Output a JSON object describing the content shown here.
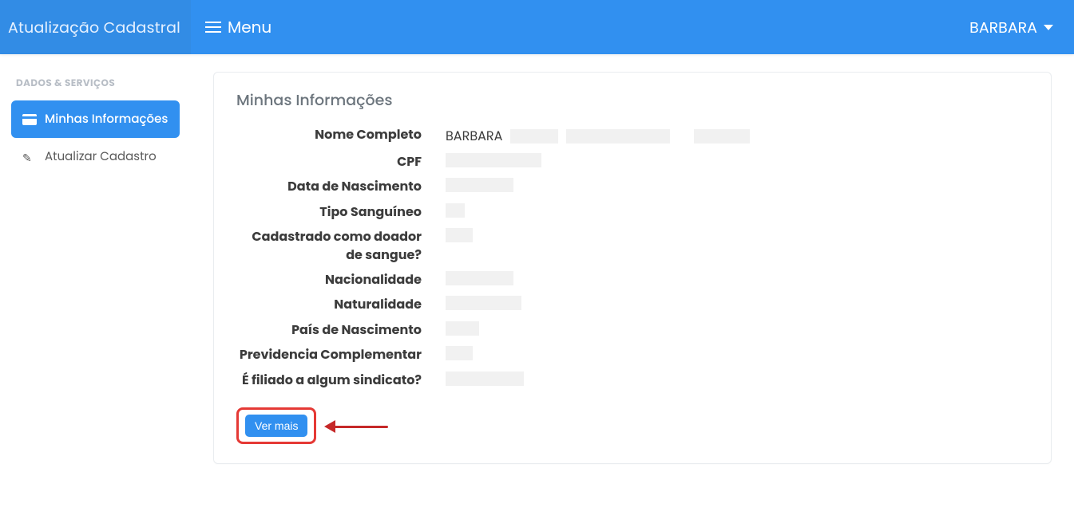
{
  "brand": "Atualização Cadastral",
  "menu_label": "Menu",
  "user_name": "BARBARA",
  "sidebar": {
    "section": "DADOS & SERVIÇOS",
    "items": [
      {
        "label": "Minhas Informações",
        "active": true
      },
      {
        "label": "Atualizar Cadastro",
        "active": false
      }
    ]
  },
  "card": {
    "title": "Minhas Informações",
    "fields": [
      {
        "label": "Nome Completo",
        "value": "BARBARA"
      },
      {
        "label": "CPF",
        "value": ""
      },
      {
        "label": "Data de Nascimento",
        "value": ""
      },
      {
        "label": "Tipo Sanguíneo",
        "value": ""
      },
      {
        "label": "Cadastrado como doador de sangue?",
        "value": ""
      },
      {
        "label": "Nacionalidade",
        "value": ""
      },
      {
        "label": "Naturalidade",
        "value": ""
      },
      {
        "label": "País de Nascimento",
        "value": ""
      },
      {
        "label": "Previdencia Complementar",
        "value": ""
      },
      {
        "label": "É filiado a algum sindicato?",
        "value": ""
      }
    ],
    "see_more": "Ver mais"
  }
}
